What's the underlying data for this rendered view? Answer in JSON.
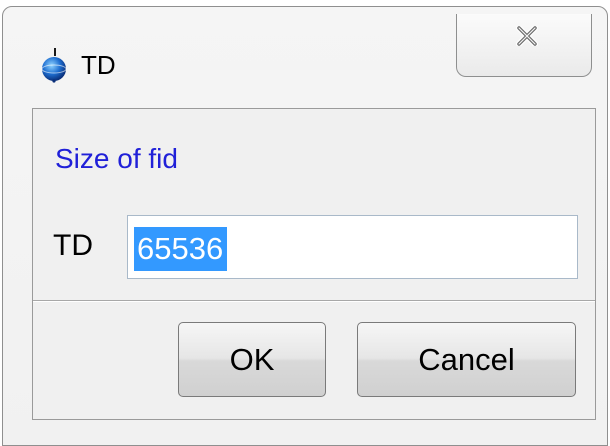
{
  "window": {
    "title": "TD",
    "icon": "app-globe-icon",
    "close_icon": "close-icon"
  },
  "dialog": {
    "prompt": "Size of fid",
    "field_label": "TD",
    "field_value": "65536",
    "field_value_selected": true
  },
  "buttons": {
    "ok_label": "OK",
    "cancel_label": "Cancel"
  },
  "colors": {
    "prompt_text": "#2020d8",
    "selection_bg": "#3399ff",
    "dialog_bg": "#f0f0f0"
  }
}
